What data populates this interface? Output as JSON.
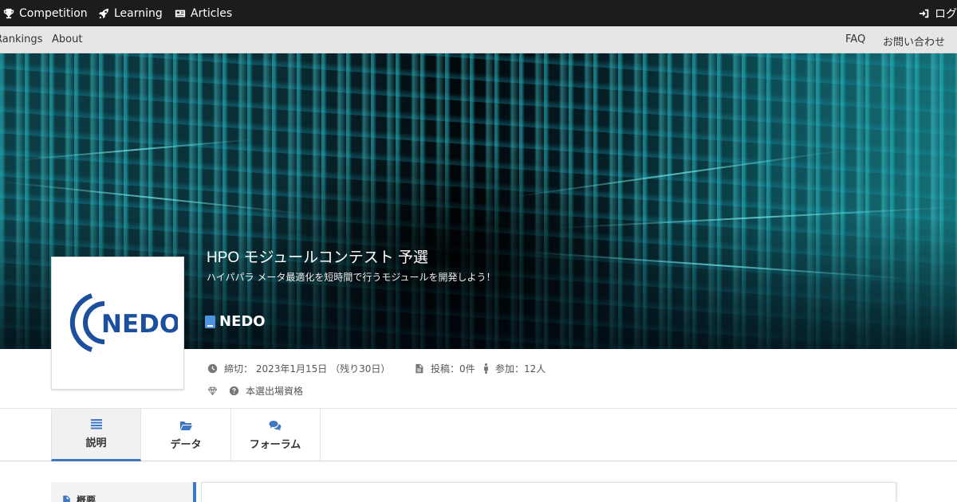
{
  "topnav": {
    "competition": "Competition",
    "learning": "Learning",
    "articles": "Articles",
    "login": "ログ"
  },
  "subnav": {
    "rankings": "Rankings",
    "about": "About",
    "faq": "FAQ",
    "contact": "お問い合わせ"
  },
  "competition": {
    "title": "HPO モジュールコンテスト 予選",
    "subtitle": "ハイパパラ メータ最適化を短時間で行うモジュールを開発しよう！",
    "organizer": "NEDO",
    "logo_text": "NEDO",
    "deadline": "締切： 2023年1月15日 （残り30日）",
    "posts": "投稿：0件",
    "participants": "参加：12人",
    "qualification": "本選出場資格"
  },
  "tabs": [
    {
      "label": "説明",
      "icon": "list-icon",
      "active": true
    },
    {
      "label": "データ",
      "icon": "folder-icon",
      "active": false
    },
    {
      "label": "フォーラム",
      "icon": "comments-icon",
      "active": false
    }
  ],
  "sidebar": {
    "items": [
      {
        "label": "概要",
        "icon": "file-icon"
      }
    ]
  },
  "colors": {
    "topnav_bg": "#1c1c1c",
    "subnav_bg": "#e6e6e6",
    "accent": "#3f77c2",
    "nedo_blue": "#1d4f9f"
  }
}
